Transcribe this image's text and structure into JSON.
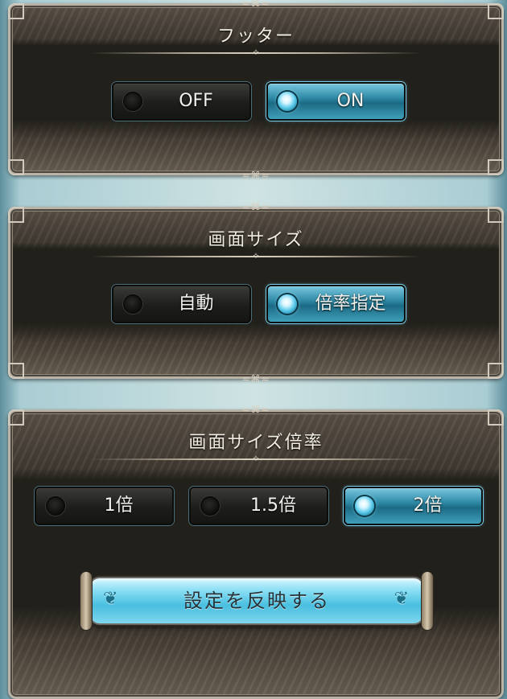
{
  "footer": {
    "title": "フッター",
    "options": [
      {
        "label": "OFF",
        "selected": false
      },
      {
        "label": "ON",
        "selected": true
      }
    ]
  },
  "screen_size": {
    "title": "画面サイズ",
    "options": [
      {
        "label": "自動",
        "selected": false
      },
      {
        "label": "倍率指定",
        "selected": true
      }
    ]
  },
  "screen_scale": {
    "title": "画面サイズ倍率",
    "options": [
      {
        "label": "1倍",
        "selected": false
      },
      {
        "label": "1.5倍",
        "selected": false
      },
      {
        "label": "2倍",
        "selected": true
      }
    ]
  },
  "apply_button": {
    "label": "設定を反映する"
  },
  "icons": {
    "radio_on": "radio-selected-icon",
    "radio_off": "radio-unselected-icon",
    "ornament": "flourish-ornament-icon"
  },
  "colors": {
    "accent": "#2f8aa6",
    "panel_bg": "#22201b",
    "frame": "#b9b2a6",
    "apply_button": "#49bfdf"
  }
}
